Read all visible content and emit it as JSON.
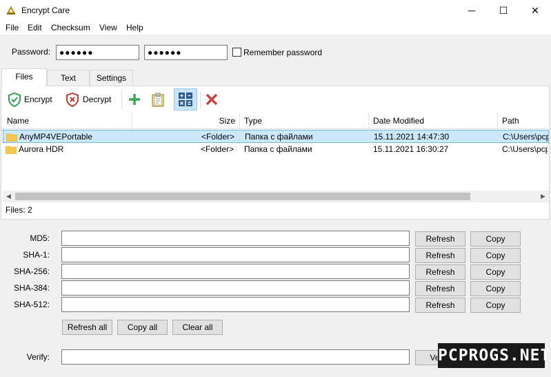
{
  "window": {
    "title": "Encrypt Care",
    "min_glyph": "─",
    "max_glyph": "☐",
    "close_glyph": "✕"
  },
  "menu": [
    "File",
    "Edit",
    "Checksum",
    "View",
    "Help"
  ],
  "password": {
    "label": "Password:",
    "value1": "●●●●●●",
    "value2": "●●●●●●",
    "remember_label": "Remember password"
  },
  "tabs": [
    "Files",
    "Text",
    "Settings"
  ],
  "toolbar": {
    "encrypt_label": "Encrypt",
    "decrypt_label": "Decrypt"
  },
  "columns": [
    "Name",
    "Size",
    "Type",
    "Date Modified",
    "Path"
  ],
  "rows": [
    {
      "name": "AnyMP4VEPortable",
      "size": "<Folder>",
      "type": "Папка с файлами",
      "date": "15.11.2021 14:47:30",
      "path": "C:\\Users\\pcp"
    },
    {
      "name": "Aurora HDR",
      "size": "<Folder>",
      "type": "Папка с файлами",
      "date": "15.11.2021 16:30:27",
      "path": "C:\\Users\\pcp"
    }
  ],
  "status": {
    "files_count": "Files: 2"
  },
  "hashes": [
    {
      "label": "MD5:",
      "value": ""
    },
    {
      "label": "SHA-1:",
      "value": ""
    },
    {
      "label": "SHA-256:",
      "value": ""
    },
    {
      "label": "SHA-384:",
      "value": ""
    },
    {
      "label": "SHA-512:",
      "value": ""
    }
  ],
  "buttons": {
    "refresh": "Refresh",
    "copy": "Copy",
    "refresh_all": "Refresh all",
    "copy_all": "Copy all",
    "clear_all": "Clear all",
    "verify": "Verify"
  },
  "verify": {
    "label": "Verify:",
    "value": ""
  },
  "watermark": "PCPROGS.NET",
  "colors": {
    "accent_selection": "#cce8ff",
    "encrypt_green": "#2e9e4f",
    "decrypt_red": "#c0392b",
    "add_green": "#3aa856",
    "delete_red": "#d0433b"
  }
}
